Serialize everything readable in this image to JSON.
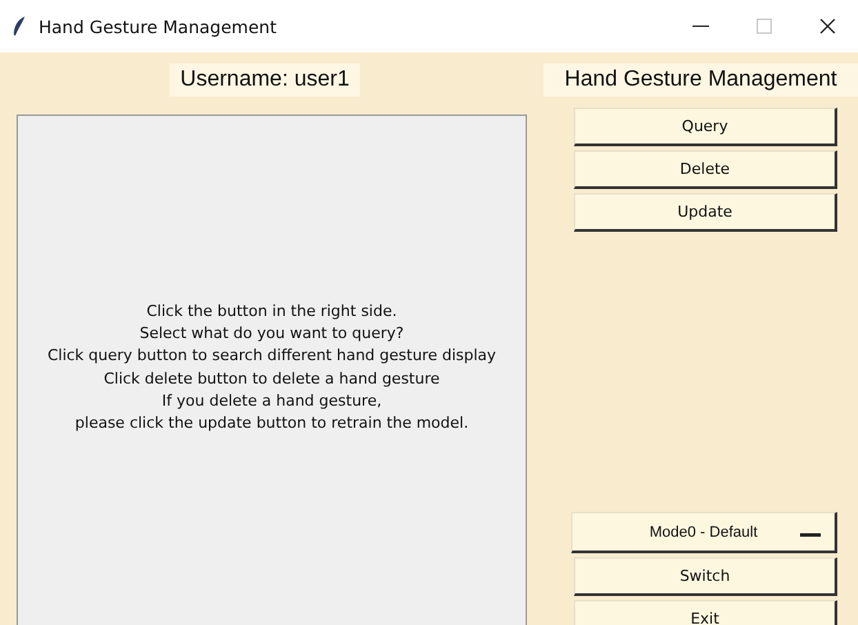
{
  "window": {
    "title": "Hand Gesture Management",
    "controls": [
      {
        "kind": "minimize",
        "disabled": false
      },
      {
        "kind": "maximize",
        "disabled": true
      },
      {
        "kind": "close",
        "disabled": false
      }
    ]
  },
  "username_label": "Username: user1",
  "heading": "Hand Gesture Management",
  "info_text": "Click the button in the right side.\nSelect what do you want to query?\nClick query button to search different hand gesture display\nClick delete button to delete a hand gesture\nIf you delete a hand gesture,\nplease click the update button to retrain the model.",
  "action_buttons": [
    "Query",
    "Delete",
    "Update"
  ],
  "mode_dropdown": {
    "value": "Mode0 - Default"
  },
  "bottom_buttons": [
    "Switch",
    "Exit"
  ]
}
